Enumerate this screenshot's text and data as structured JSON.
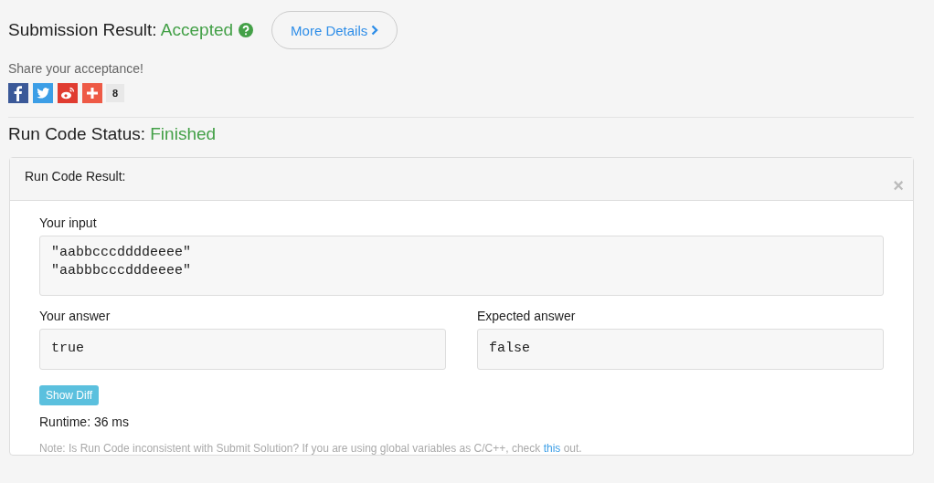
{
  "submission": {
    "label": "Submission Result:",
    "status": "Accepted",
    "details_button": "More Details"
  },
  "share": {
    "prompt": "Share your acceptance!",
    "count": "8"
  },
  "run_status": {
    "label": "Run Code Status:",
    "status": "Finished"
  },
  "panel": {
    "title": "Run Code Result:",
    "close": "×",
    "input": {
      "label": "Your input",
      "lines": [
        "\"aabbcccddddeeee\"",
        "\"aabbbcccdddeeee\""
      ]
    },
    "answers": [
      {
        "label": "Your answer",
        "value": "true"
      },
      {
        "label": "Expected answer",
        "value": "false"
      }
    ],
    "diff_button": "Show Diff",
    "runtime": "Runtime: 36 ms",
    "note": {
      "text": "Note: Is Run Code inconsistent with Submit Solution? If you are using global variables as C/C++, check",
      "link": "this",
      "after": "out."
    }
  }
}
